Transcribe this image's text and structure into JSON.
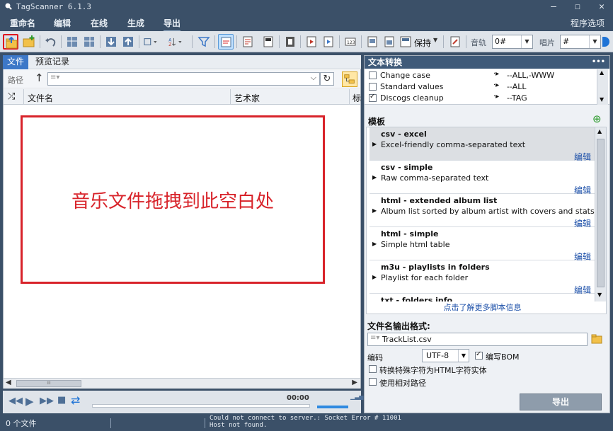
{
  "window": {
    "title": "TagScanner 6.1.3",
    "controls": [
      "minimize",
      "maximize",
      "close"
    ]
  },
  "menubar": {
    "items": [
      "重命名",
      "编辑",
      "在线",
      "生成",
      "导出"
    ],
    "active": "导出",
    "program_options": "程序选项"
  },
  "toolbar": {
    "keep_label": "保持",
    "track_label": "音轨",
    "track_value": "0#",
    "disc_label": "唱片",
    "disc_value": "#"
  },
  "left": {
    "tabs": [
      "文件",
      "预览记录"
    ],
    "active_tab": "文件",
    "path_label": "路径",
    "path_value": "",
    "columns": [
      "文件名",
      "艺术家",
      "标"
    ],
    "drop_hint": "音乐文件拖拽到此空白处",
    "player_time": "00:00",
    "scroll_mark": "III"
  },
  "right": {
    "text_transform": {
      "header": "文本转换",
      "items": [
        {
          "label": "Change case",
          "checked": false,
          "value": "--ALL,-WWW"
        },
        {
          "label": "Standard values",
          "checked": false,
          "value": "--ALL"
        },
        {
          "label": "Discogs cleanup",
          "checked": true,
          "value": "--TAG"
        }
      ]
    },
    "templates": {
      "header": "模板",
      "items": [
        {
          "name": "csv - excel",
          "desc": "Excel-friendly comma-separated text",
          "edit": "编辑",
          "selected": true
        },
        {
          "name": "csv - simple",
          "desc": "Raw comma-separated text",
          "edit": "编辑",
          "selected": false
        },
        {
          "name": "html - extended album list",
          "desc": "Album list sorted by album artist with covers and stats",
          "edit": "编辑",
          "selected": false
        },
        {
          "name": "html - simple",
          "desc": "Simple html table",
          "edit": "编辑",
          "selected": false
        },
        {
          "name": "m3u - playlists in folders",
          "desc": "Playlist for each folder",
          "edit": "编辑",
          "selected": false
        },
        {
          "name": "txt - folders info",
          "desc": "",
          "edit": "",
          "selected": false
        }
      ],
      "more_link": "点击了解更多脚本信息"
    },
    "output": {
      "filename_label": "文件名输出格式:",
      "filename_value": "TrackList.csv",
      "encoding_label": "编码",
      "encoding_value": "UTF-8",
      "write_bom_label": "编写BOM",
      "write_bom_checked": true,
      "html_entities_label": "转换特殊字符为HTML字符实体",
      "html_entities_checked": false,
      "relative_path_label": "使用相对路径",
      "relative_path_checked": false,
      "export_button": "导出"
    }
  },
  "status": {
    "file_count": "0 个文件",
    "messages": [
      "Could not connect to server.: Socket Error # 11001",
      "Host not found."
    ]
  },
  "colors": {
    "chrome": "#3b5068",
    "accent": "#3d78c8",
    "highlight_red": "#d8232a",
    "link": "#1a4ea8"
  }
}
